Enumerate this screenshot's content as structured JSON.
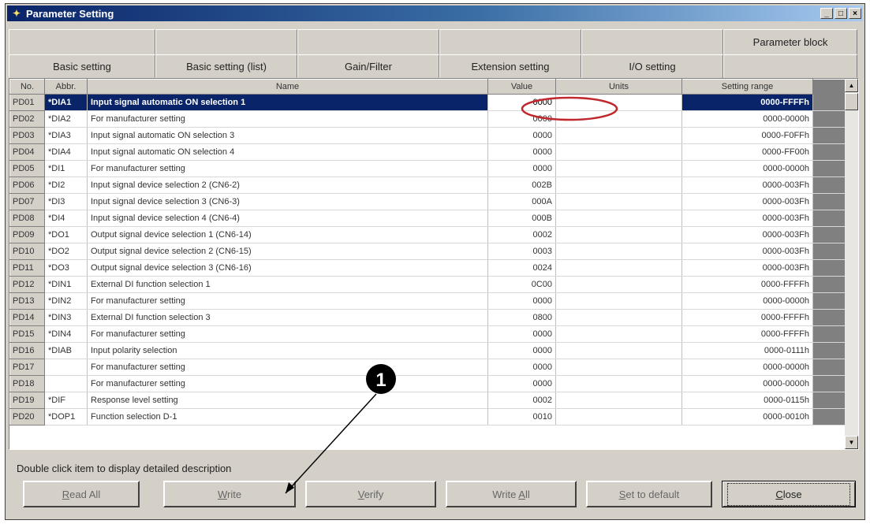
{
  "window": {
    "title": "Parameter Setting",
    "min_label": "_",
    "max_label": "□",
    "close_label": "×"
  },
  "tabs_top": [
    "",
    "",
    "",
    "",
    "",
    "Parameter block"
  ],
  "tabs_bottom": [
    "Basic setting",
    "Basic setting (list)",
    "Gain/Filter",
    "Extension setting",
    "I/O setting",
    ""
  ],
  "active_tab": "I/O setting",
  "table": {
    "headers": {
      "no": "No.",
      "abbr": "Abbr.",
      "name": "Name",
      "value": "Value",
      "units": "Units",
      "range": "Setting range"
    },
    "rows": [
      {
        "no": "PD01",
        "abbr": "*DIA1",
        "name": "Input signal automatic ON selection 1",
        "value": "0000",
        "units": "",
        "range": "0000-FFFFh"
      },
      {
        "no": "PD02",
        "abbr": "*DIA2",
        "name": "For manufacturer setting",
        "value": "0000",
        "units": "",
        "range": "0000-0000h"
      },
      {
        "no": "PD03",
        "abbr": "*DIA3",
        "name": "Input signal automatic ON selection 3",
        "value": "0000",
        "units": "",
        "range": "0000-F0FFh"
      },
      {
        "no": "PD04",
        "abbr": "*DIA4",
        "name": "Input signal automatic ON selection 4",
        "value": "0000",
        "units": "",
        "range": "0000-FF00h"
      },
      {
        "no": "PD05",
        "abbr": "*DI1",
        "name": "For manufacturer setting",
        "value": "0000",
        "units": "",
        "range": "0000-0000h"
      },
      {
        "no": "PD06",
        "abbr": "*DI2",
        "name": "Input signal device selection 2 (CN6-2)",
        "value": "002B",
        "units": "",
        "range": "0000-003Fh"
      },
      {
        "no": "PD07",
        "abbr": "*DI3",
        "name": "Input signal device selection 3 (CN6-3)",
        "value": "000A",
        "units": "",
        "range": "0000-003Fh"
      },
      {
        "no": "PD08",
        "abbr": "*DI4",
        "name": "Input signal device selection 4 (CN6-4)",
        "value": "000B",
        "units": "",
        "range": "0000-003Fh"
      },
      {
        "no": "PD09",
        "abbr": "*DO1",
        "name": "Output signal device selection 1 (CN6-14)",
        "value": "0002",
        "units": "",
        "range": "0000-003Fh"
      },
      {
        "no": "PD10",
        "abbr": "*DO2",
        "name": "Output signal device selection 2 (CN6-15)",
        "value": "0003",
        "units": "",
        "range": "0000-003Fh"
      },
      {
        "no": "PD11",
        "abbr": "*DO3",
        "name": "Output signal device selection 3 (CN6-16)",
        "value": "0024",
        "units": "",
        "range": "0000-003Fh"
      },
      {
        "no": "PD12",
        "abbr": "*DIN1",
        "name": "External DI function selection 1",
        "value": "0C00",
        "units": "",
        "range": "0000-FFFFh"
      },
      {
        "no": "PD13",
        "abbr": "*DIN2",
        "name": "For manufacturer setting",
        "value": "0000",
        "units": "",
        "range": "0000-0000h"
      },
      {
        "no": "PD14",
        "abbr": "*DIN3",
        "name": "External DI function selection 3",
        "value": "0800",
        "units": "",
        "range": "0000-FFFFh"
      },
      {
        "no": "PD15",
        "abbr": "*DIN4",
        "name": "For manufacturer setting",
        "value": "0000",
        "units": "",
        "range": "0000-FFFFh"
      },
      {
        "no": "PD16",
        "abbr": "*DIAB",
        "name": "Input polarity selection",
        "value": "0000",
        "units": "",
        "range": "0000-0111h"
      },
      {
        "no": "PD17",
        "abbr": "",
        "name": "For manufacturer setting",
        "value": "0000",
        "units": "",
        "range": "0000-0000h"
      },
      {
        "no": "PD18",
        "abbr": "",
        "name": "For manufacturer setting",
        "value": "0000",
        "units": "",
        "range": "0000-0000h"
      },
      {
        "no": "PD19",
        "abbr": "*DIF",
        "name": "Response level setting",
        "value": "0002",
        "units": "",
        "range": "0000-0115h"
      },
      {
        "no": "PD20",
        "abbr": "*DOP1",
        "name": "Function selection D-1",
        "value": "0010",
        "units": "",
        "range": "0000-0010h"
      }
    ]
  },
  "status_text": "Double click item to display detailed description",
  "buttons": {
    "read_all": {
      "mn": "R",
      "rest": "ead All"
    },
    "write": {
      "mn": "W",
      "rest": "rite"
    },
    "verify": {
      "mn": "V",
      "rest": "erify"
    },
    "write_all": {
      "pre": "Write ",
      "mn": "A",
      "rest": "ll"
    },
    "set_default": {
      "mn": "S",
      "rest": "et to default"
    },
    "close": {
      "mn": "C",
      "rest": "lose"
    }
  },
  "annotation": {
    "callout_number": "1",
    "highlight_color": "#c0282d"
  }
}
